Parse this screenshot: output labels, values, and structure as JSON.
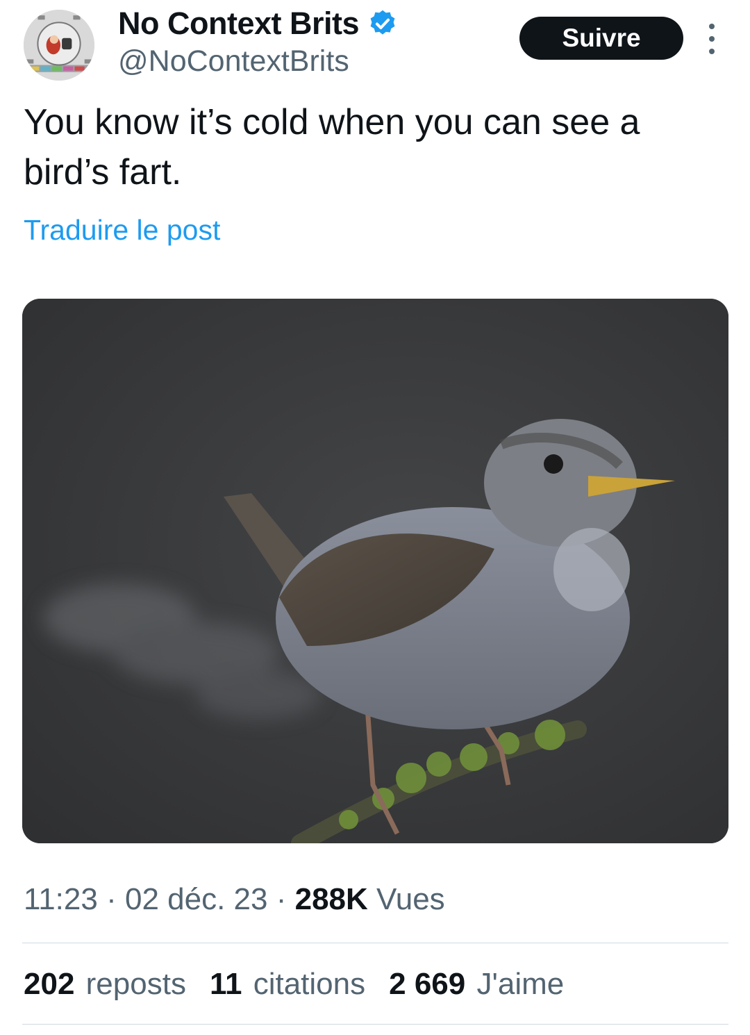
{
  "author": {
    "display_name": "No Context Brits",
    "handle": "@NoContextBrits",
    "verified_icon": "verified-badge-icon",
    "accent_color": "#1d9bf0"
  },
  "actions": {
    "follow_label": "Suivre",
    "more_icon": "more-vertical-icon"
  },
  "post": {
    "text": "You know it’s cold when you can see a bird’s fart.",
    "translate_label": "Traduire le post",
    "media_alt": "wren-photo"
  },
  "meta": {
    "time": "11:23",
    "separator": "·",
    "date": "02 déc. 23",
    "views_count": "288K",
    "views_label": "Vues"
  },
  "stats": [
    {
      "count": "202",
      "label": "reposts"
    },
    {
      "count": "11",
      "label": "citations"
    },
    {
      "count": "2 669",
      "label": "J'aime"
    }
  ]
}
